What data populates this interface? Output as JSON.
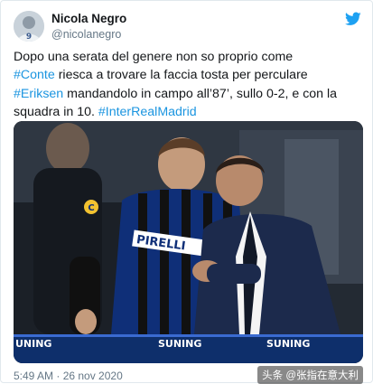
{
  "author": {
    "name": "Nicola Negro",
    "handle": "@nicolanegro"
  },
  "tweet": {
    "t1": "Dopo una serata del genere non so proprio come",
    "h1": "#Conte",
    "t2": " riesca a trovare la faccia tosta per perculare",
    "h2": "#Eriksen",
    "t3": " mandandolo in campo all’87’, sullo 0-2, e con la squadra in 10. ",
    "h3": "#InterRealMadrid"
  },
  "timestamp": "5:49 AM · 26 nov 2020",
  "photo": {
    "jersey_sponsor": "PIRELLI",
    "jersey_number": "C",
    "board_left": "UNING",
    "board_mid": "SUNING",
    "board_right": "SUNING"
  },
  "watermark": "头条 @张指在意大利",
  "colors": {
    "hashtag": "#1b95e0",
    "twitter_blue": "#1da1f2",
    "muted": "#657786"
  },
  "icons": {
    "brand": "twitter-bird-icon"
  }
}
